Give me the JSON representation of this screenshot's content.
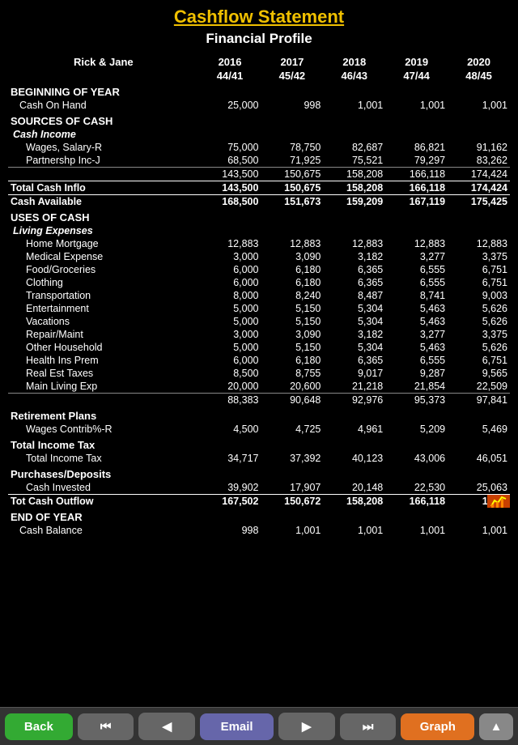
{
  "title": "Cashflow Statement",
  "subtitle": "Financial Profile",
  "names": {
    "label": "Rick & Jane",
    "years": [
      "2016",
      "2017",
      "2018",
      "2019",
      "2020"
    ],
    "ages": [
      "44/41",
      "45/42",
      "46/43",
      "47/44",
      "48/45"
    ]
  },
  "beginning_of_year": {
    "header": "BEGINNING OF YEAR",
    "cash_on_hand": {
      "label": "Cash On Hand",
      "values": [
        "25,000",
        "998",
        "1,001",
        "1,001",
        "1,001"
      ]
    }
  },
  "sources_of_cash": {
    "header": "SOURCES OF CASH",
    "cash_income_header": "Cash Income",
    "wages_r": {
      "label": "Wages, Salary-R",
      "values": [
        "75,000",
        "78,750",
        "82,687",
        "86,821",
        "91,162"
      ]
    },
    "partnership_j": {
      "label": "Partnershp Inc-J",
      "values": [
        "68,500",
        "71,925",
        "75,521",
        "79,297",
        "83,262"
      ]
    },
    "subtotal": {
      "label": "",
      "values": [
        "143,500",
        "150,675",
        "158,208",
        "166,118",
        "174,424"
      ]
    },
    "total_cash_inflow": {
      "label": "Total Cash Inflo",
      "values": [
        "143,500",
        "150,675",
        "158,208",
        "166,118",
        "174,424"
      ]
    },
    "cash_available": {
      "label": "Cash Available",
      "values": [
        "168,500",
        "151,673",
        "159,209",
        "167,119",
        "175,425"
      ]
    }
  },
  "uses_of_cash": {
    "header": "USES OF CASH",
    "living_expenses_header": "Living Expenses",
    "home_mortgage": {
      "label": "Home Mortgage",
      "values": [
        "12,883",
        "12,883",
        "12,883",
        "12,883",
        "12,883"
      ]
    },
    "medical": {
      "label": "Medical Expense",
      "values": [
        "3,000",
        "3,090",
        "3,182",
        "3,277",
        "3,375"
      ]
    },
    "food": {
      "label": "Food/Groceries",
      "values": [
        "6,000",
        "6,180",
        "6,365",
        "6,555",
        "6,751"
      ]
    },
    "clothing": {
      "label": "Clothing",
      "values": [
        "6,000",
        "6,180",
        "6,365",
        "6,555",
        "6,751"
      ]
    },
    "transportation": {
      "label": "Transportation",
      "values": [
        "8,000",
        "8,240",
        "8,487",
        "8,741",
        "9,003"
      ]
    },
    "entertainment": {
      "label": "Entertainment",
      "values": [
        "5,000",
        "5,150",
        "5,304",
        "5,463",
        "5,626"
      ]
    },
    "vacations": {
      "label": "Vacations",
      "values": [
        "5,000",
        "5,150",
        "5,304",
        "5,463",
        "5,626"
      ]
    },
    "repair": {
      "label": "Repair/Maint",
      "values": [
        "3,000",
        "3,090",
        "3,182",
        "3,277",
        "3,375"
      ]
    },
    "other_household": {
      "label": "Other Household",
      "values": [
        "5,000",
        "5,150",
        "5,304",
        "5,463",
        "5,626"
      ]
    },
    "health_ins": {
      "label": "Health Ins Prem",
      "values": [
        "6,000",
        "6,180",
        "6,365",
        "6,555",
        "6,751"
      ]
    },
    "real_est_taxes": {
      "label": "Real Est Taxes",
      "values": [
        "8,500",
        "8,755",
        "9,017",
        "9,287",
        "9,565"
      ]
    },
    "main_living": {
      "label": "Main Living Exp",
      "values": [
        "20,000",
        "20,600",
        "21,218",
        "21,854",
        "22,509"
      ]
    },
    "subtotal": {
      "label": "",
      "values": [
        "88,383",
        "90,648",
        "92,976",
        "95,373",
        "97,841"
      ]
    },
    "retirement_header": "Retirement Plans",
    "wages_contrib": {
      "label": "Wages Contrib%-R",
      "values": [
        "4,500",
        "4,725",
        "4,961",
        "5,209",
        "5,469"
      ]
    },
    "income_tax_header": "Total Income Tax",
    "total_income_tax": {
      "label": "Total Income Tax",
      "values": [
        "34,717",
        "37,392",
        "40,123",
        "43,006",
        "46,051"
      ]
    },
    "purchases_header": "Purchases/Deposits",
    "cash_invested": {
      "label": "Cash Invested",
      "values": [
        "39,902",
        "17,907",
        "20,148",
        "22,530",
        "25,063"
      ]
    },
    "total_cash_outflow": {
      "label": "Tot Cash Outflow",
      "values": [
        "167,502",
        "150,672",
        "158,208",
        "166,118",
        "174,4.."
      ]
    }
  },
  "end_of_year": {
    "header": "END OF YEAR",
    "cash_balance": {
      "label": "Cash Balance",
      "values": [
        "998",
        "1,001",
        "1,001",
        "1,001",
        "1,001"
      ]
    }
  },
  "toolbar": {
    "back_label": "Back",
    "rewind_label": "⏮",
    "prev_label": "◀",
    "email_label": "Email",
    "next_label": "▶",
    "forward_label": "⏭",
    "graph_label": "Graph",
    "up_label": "▲"
  }
}
